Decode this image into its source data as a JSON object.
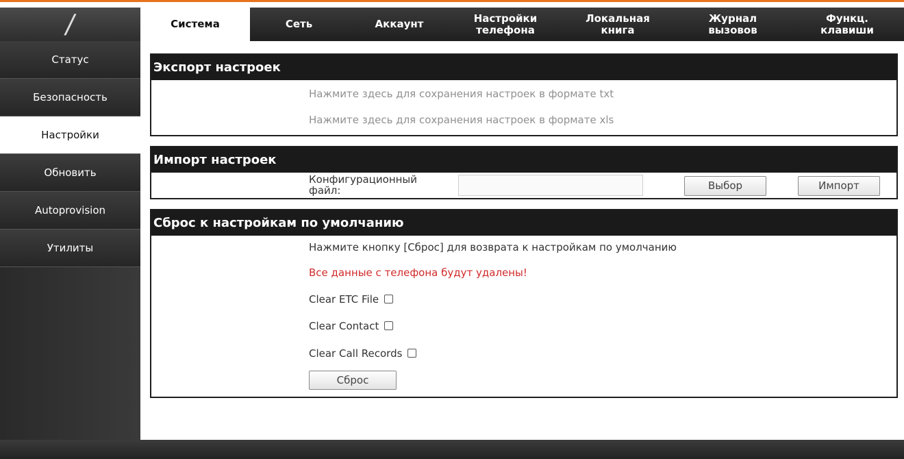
{
  "logo": {
    "glyph": "/"
  },
  "topnav": {
    "tabs": [
      {
        "line1": "Система",
        "line2": ""
      },
      {
        "line1": "Сеть",
        "line2": ""
      },
      {
        "line1": "Аккаунт",
        "line2": ""
      },
      {
        "line1": "Настройки",
        "line2": "телефона"
      },
      {
        "line1": "Локальная",
        "line2": "книга"
      },
      {
        "line1": "Журнал",
        "line2": "вызовов"
      },
      {
        "line1": "Функц.",
        "line2": "клавиши"
      }
    ],
    "active_index": 0
  },
  "sidebar": {
    "items": [
      {
        "label": "Статус"
      },
      {
        "label": "Безопасность"
      },
      {
        "label": "Настройки"
      },
      {
        "label": "Обновить"
      },
      {
        "label": "Autoprovision"
      },
      {
        "label": "Утилиты"
      }
    ],
    "active_index": 2
  },
  "export": {
    "title": "Экспорт настроек",
    "link_txt": "Нажмите здесь для сохранения настроек в формате txt",
    "link_xls": "Нажмите здесь для сохранения настроек в формате xls"
  },
  "import": {
    "title": "Импорт настроек",
    "file_label_line1": "Конфигурационный",
    "file_label_line2": "файл:",
    "file_value": "",
    "choose_label": "Выбор",
    "import_label": "Импорт"
  },
  "reset": {
    "title": "Сброс к настройкам по умолчанию",
    "instruction": "Нажмите кнопку [Сброс] для возврата к настройкам по умолчанию",
    "warning": "Все данные с телефона будут удалены!",
    "opt_etc": "Clear ETC File",
    "opt_contact": "Clear Contact",
    "opt_calls": "Clear Call Records",
    "button_label": "Сброс"
  },
  "colors": {
    "accent": "#e8731c",
    "warning": "#d22b2b",
    "header_bg": "#1a1a1a"
  }
}
